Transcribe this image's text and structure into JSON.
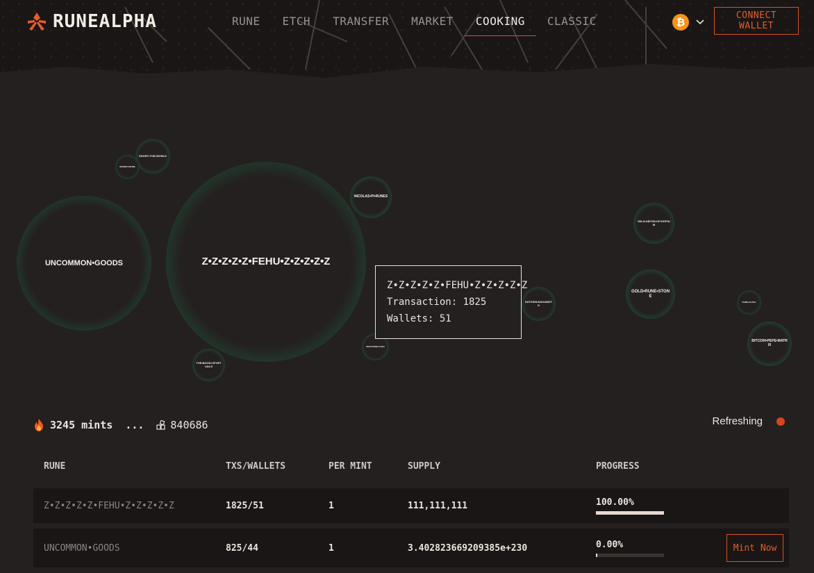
{
  "header": {
    "logo_text": "RUNEALPHA",
    "nav": [
      {
        "label": "RUNE",
        "active": false
      },
      {
        "label": "ETCH",
        "active": false
      },
      {
        "label": "TRANSFER",
        "active": false
      },
      {
        "label": "MARKET",
        "active": false
      },
      {
        "label": "COOKING",
        "active": true
      },
      {
        "label": "CLASSIC",
        "active": false
      }
    ],
    "chain_icon": "bitcoin-icon",
    "connect_label": "CONNECT WALLET"
  },
  "bubbles": [
    {
      "name": "UNCOMMON•GOODS"
    },
    {
      "name": "Z•Z•Z•Z•Z•FEHU•Z•Z•Z•Z•Z"
    },
    {
      "name": "SHORT•THE•WORLD"
    },
    {
      "name": "MARKET•RUNE"
    },
    {
      "name": "NICOLAS•PI•RUNES"
    },
    {
      "name": "THE•BOOK•OF•RITUALS"
    },
    {
      "name": "WIZZ•RUNE•CASH"
    },
    {
      "name": "SATOSHI•NAKAMOTO"
    },
    {
      "name": "WILD•ABYSS•OF•HOPIUM"
    },
    {
      "name": "GOLD•RUNE•STONE"
    },
    {
      "name": "RUNE•ALPHA"
    },
    {
      "name": "BITCOIN•PEPE•MATRIX"
    }
  ],
  "tooltip": {
    "name": "Z•Z•Z•Z•Z•FEHU•Z•Z•Z•Z•Z",
    "transaction": "Transaction: 1825",
    "wallets": "Wallets: 51"
  },
  "stats": {
    "mints": "3245 mints",
    "dots": "...",
    "block": "840686",
    "refresh_label": "Refreshing"
  },
  "table": {
    "headers": [
      "RUNE",
      "TXS/WALLETS",
      "PER MINT",
      "SUPPLY",
      "PROGRESS"
    ],
    "rows": [
      {
        "rune": "Z•Z•Z•Z•Z•FEHU•Z•Z•Z•Z•Z",
        "txs_wallets": "1825/51",
        "per_mint": "1",
        "supply": "111,111,111",
        "progress": "100.00%",
        "progress_fraction": 1.0,
        "action": ""
      },
      {
        "rune": "UNCOMMON•GOODS",
        "txs_wallets": "825/44",
        "per_mint": "1",
        "supply": "3.402823669209385e+230",
        "progress": "0.00%",
        "progress_fraction": 0.0,
        "action": "Mint Now"
      }
    ]
  },
  "colors": {
    "accent": "#d4532a",
    "bubble_glow": "#23c06a",
    "bitcoin": "#f7931a"
  }
}
